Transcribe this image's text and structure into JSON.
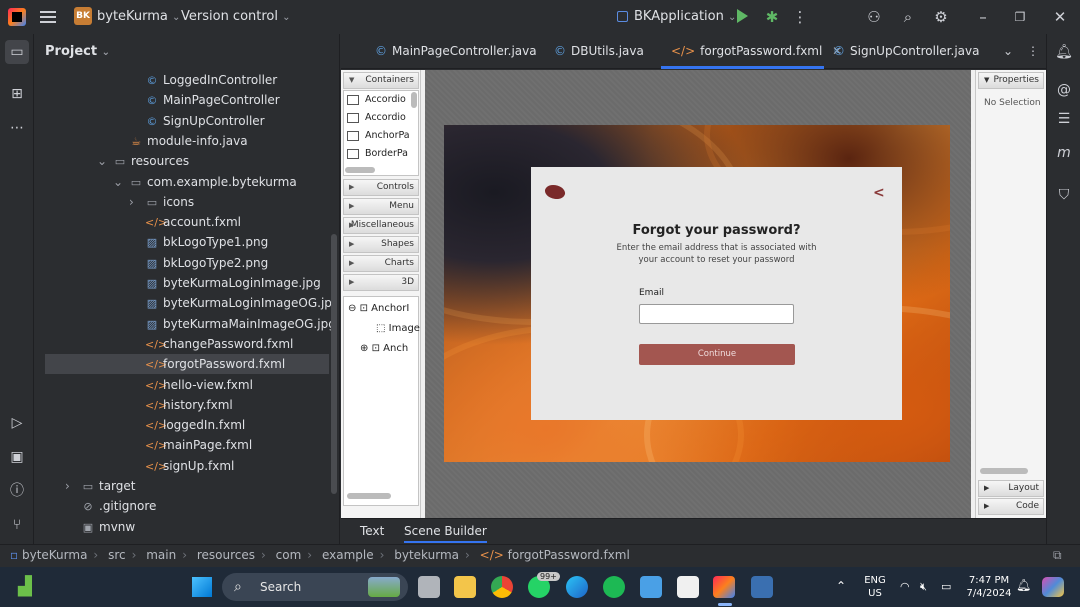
{
  "titlebar": {
    "project_badge": "BK",
    "project_name": "byteKurma",
    "vcs": "Version control",
    "run_config": "BKApplication"
  },
  "project_panel": {
    "title": "Project",
    "tree": [
      {
        "label": "LoggedInController",
        "icon": "class-icon",
        "indent": 110
      },
      {
        "label": "MainPageController",
        "icon": "class-icon",
        "indent": 110
      },
      {
        "label": "SignUpController",
        "icon": "class-icon",
        "indent": 110
      },
      {
        "label": "module-info.java",
        "icon": "java-file-icon",
        "indent": 94
      },
      {
        "label": "resources",
        "icon": "folder-icon",
        "indent": 78,
        "expander": "v"
      },
      {
        "label": "com.example.bytekurma",
        "icon": "folder-icon",
        "indent": 94,
        "expander": "v"
      },
      {
        "label": "icons",
        "icon": "folder-icon",
        "indent": 110,
        "expander": ">"
      },
      {
        "label": "account.fxml",
        "icon": "fxml-icon",
        "indent": 110
      },
      {
        "label": "bkLogoType1.png",
        "icon": "image-icon",
        "indent": 110
      },
      {
        "label": "bkLogoType2.png",
        "icon": "image-icon",
        "indent": 110
      },
      {
        "label": "byteKurmaLoginImage.jpg",
        "icon": "image-icon",
        "indent": 110
      },
      {
        "label": "byteKurmaLoginImageOG.jpg",
        "icon": "image-icon",
        "indent": 110
      },
      {
        "label": "byteKurmaMainImageOG.jpg",
        "icon": "image-icon",
        "indent": 110
      },
      {
        "label": "changePassword.fxml",
        "icon": "fxml-icon",
        "indent": 110
      },
      {
        "label": "forgotPassword.fxml",
        "icon": "fxml-icon",
        "indent": 110,
        "selected": true
      },
      {
        "label": "hello-view.fxml",
        "icon": "fxml-icon",
        "indent": 110
      },
      {
        "label": "history.fxml",
        "icon": "fxml-icon",
        "indent": 110
      },
      {
        "label": "loggedIn.fxml",
        "icon": "fxml-icon",
        "indent": 110
      },
      {
        "label": "mainPage.fxml",
        "icon": "fxml-icon",
        "indent": 110
      },
      {
        "label": "signUp.fxml",
        "icon": "fxml-icon",
        "indent": 110
      },
      {
        "label": "target",
        "icon": "folder-icon",
        "indent": 46,
        "expander": ">"
      },
      {
        "label": ".gitignore",
        "icon": "ignore-icon",
        "indent": 46
      },
      {
        "label": "mvnw",
        "icon": "terminal-icon",
        "indent": 46
      }
    ]
  },
  "tabs": [
    {
      "label": "MainPageController.java",
      "active": false
    },
    {
      "label": "DBUtils.java",
      "active": false
    },
    {
      "label": "forgotPassword.fxml",
      "active": true
    },
    {
      "label": "SignUpController.java",
      "active": false
    }
  ],
  "library": {
    "containers_header": "Containers",
    "items": [
      "Accordio",
      "Accordio",
      "AnchorPa",
      "BorderPa"
    ],
    "sections": [
      "Controls",
      "Menu",
      "Miscellaneous",
      "Shapes",
      "Charts",
      "3D"
    ],
    "hierarchy": [
      "AnchorI",
      "Image",
      "Anch"
    ]
  },
  "preview": {
    "title": "Forgot your password?",
    "subtitle": "Enter the email address that is associated with your account to reset your password",
    "email_label": "Email",
    "email_value": "",
    "continue_label": "Continue",
    "back_glyph": "<"
  },
  "properties": {
    "header": "Properties",
    "no_selection": "No Selection",
    "layout": "Layout",
    "code": "Code"
  },
  "bottom_tabs": {
    "text": "Text",
    "scene_builder": "Scene Builder"
  },
  "breadcrumb": [
    "byteKurma",
    "src",
    "main",
    "resources",
    "com",
    "example",
    "bytekurma",
    "forgotPassword.fxml"
  ],
  "taskbar": {
    "search": "Search",
    "whatsapp_badge": "99+",
    "lang_line1": "ENG",
    "lang_line2": "US",
    "time": "7:47 PM",
    "date": "7/4/2024"
  }
}
